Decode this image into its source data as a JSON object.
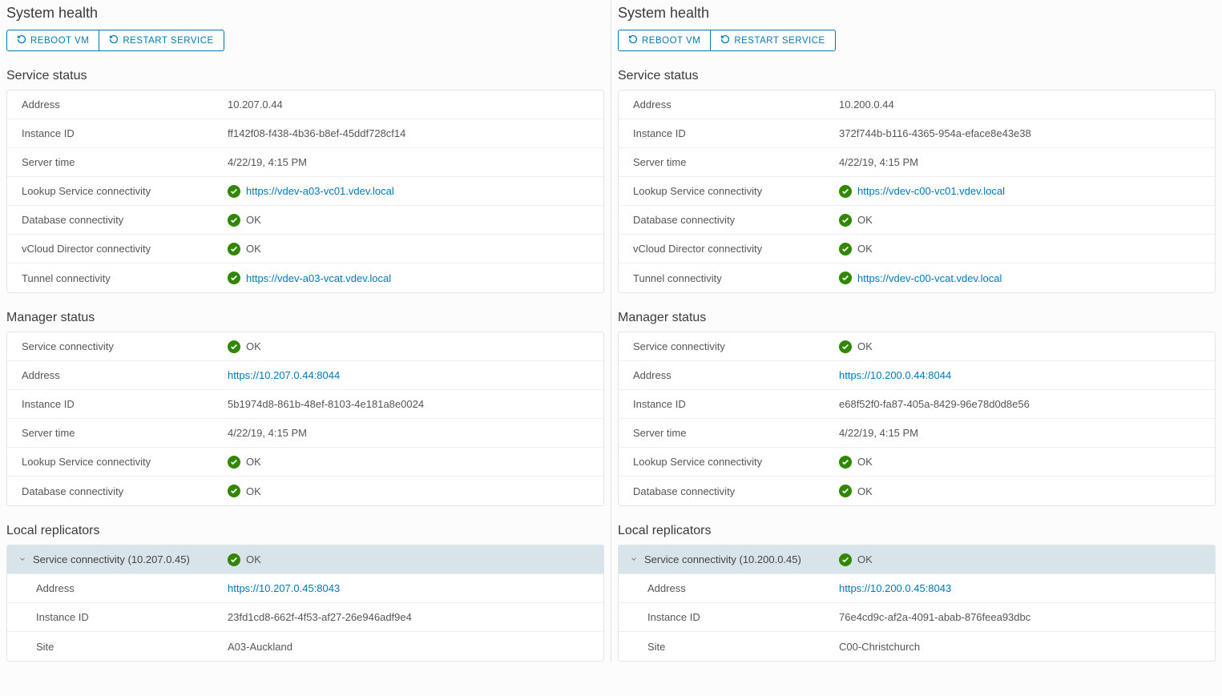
{
  "labels": {
    "system_health": "System health",
    "reboot_vm": "Reboot VM",
    "restart_service": "Restart Service",
    "service_status": "Service status",
    "manager_status": "Manager status",
    "local_replicators": "Local replicators",
    "address": "Address",
    "instance_id": "Instance ID",
    "server_time": "Server time",
    "lookup": "Lookup Service connectivity",
    "db": "Database connectivity",
    "vcd": "vCloud Director connectivity",
    "tunnel": "Tunnel connectivity",
    "svc_conn": "Service connectivity",
    "site": "Site",
    "ok": "OK"
  },
  "left": {
    "service": {
      "address": "10.207.0.44",
      "instance_id": "ff142f08-f438-4b36-b8ef-45ddf728cf14",
      "server_time": "4/22/19, 4:15 PM",
      "lookup_url": "https://vdev-a03-vc01.vdev.local",
      "tunnel_url": "https://vdev-a03-vcat.vdev.local"
    },
    "manager": {
      "address_url": "https://10.207.0.44:8044",
      "instance_id": "5b1974d8-861b-48ef-8103-4e181a8e0024",
      "server_time": "4/22/19, 4:15 PM"
    },
    "replicator": {
      "header": "Service connectivity (10.207.0.45)",
      "address_url": "https://10.207.0.45:8043",
      "instance_id": "23fd1cd8-662f-4f53-af27-26e946adf9e4",
      "site": "A03-Auckland"
    }
  },
  "right": {
    "service": {
      "address": "10.200.0.44",
      "instance_id": "372f744b-b116-4365-954a-eface8e43e38",
      "server_time": "4/22/19, 4:15 PM",
      "lookup_url": "https://vdev-c00-vc01.vdev.local",
      "tunnel_url": "https://vdev-c00-vcat.vdev.local"
    },
    "manager": {
      "address_url": "https://10.200.0.44:8044",
      "instance_id": "e68f52f0-fa87-405a-8429-96e78d0d8e56",
      "server_time": "4/22/19, 4:15 PM"
    },
    "replicator": {
      "header": "Service connectivity (10.200.0.45)",
      "address_url": "https://10.200.0.45:8043",
      "instance_id": "76e4cd9c-af2a-4091-abab-876feea93dbc",
      "site": "C00-Christchurch"
    }
  }
}
